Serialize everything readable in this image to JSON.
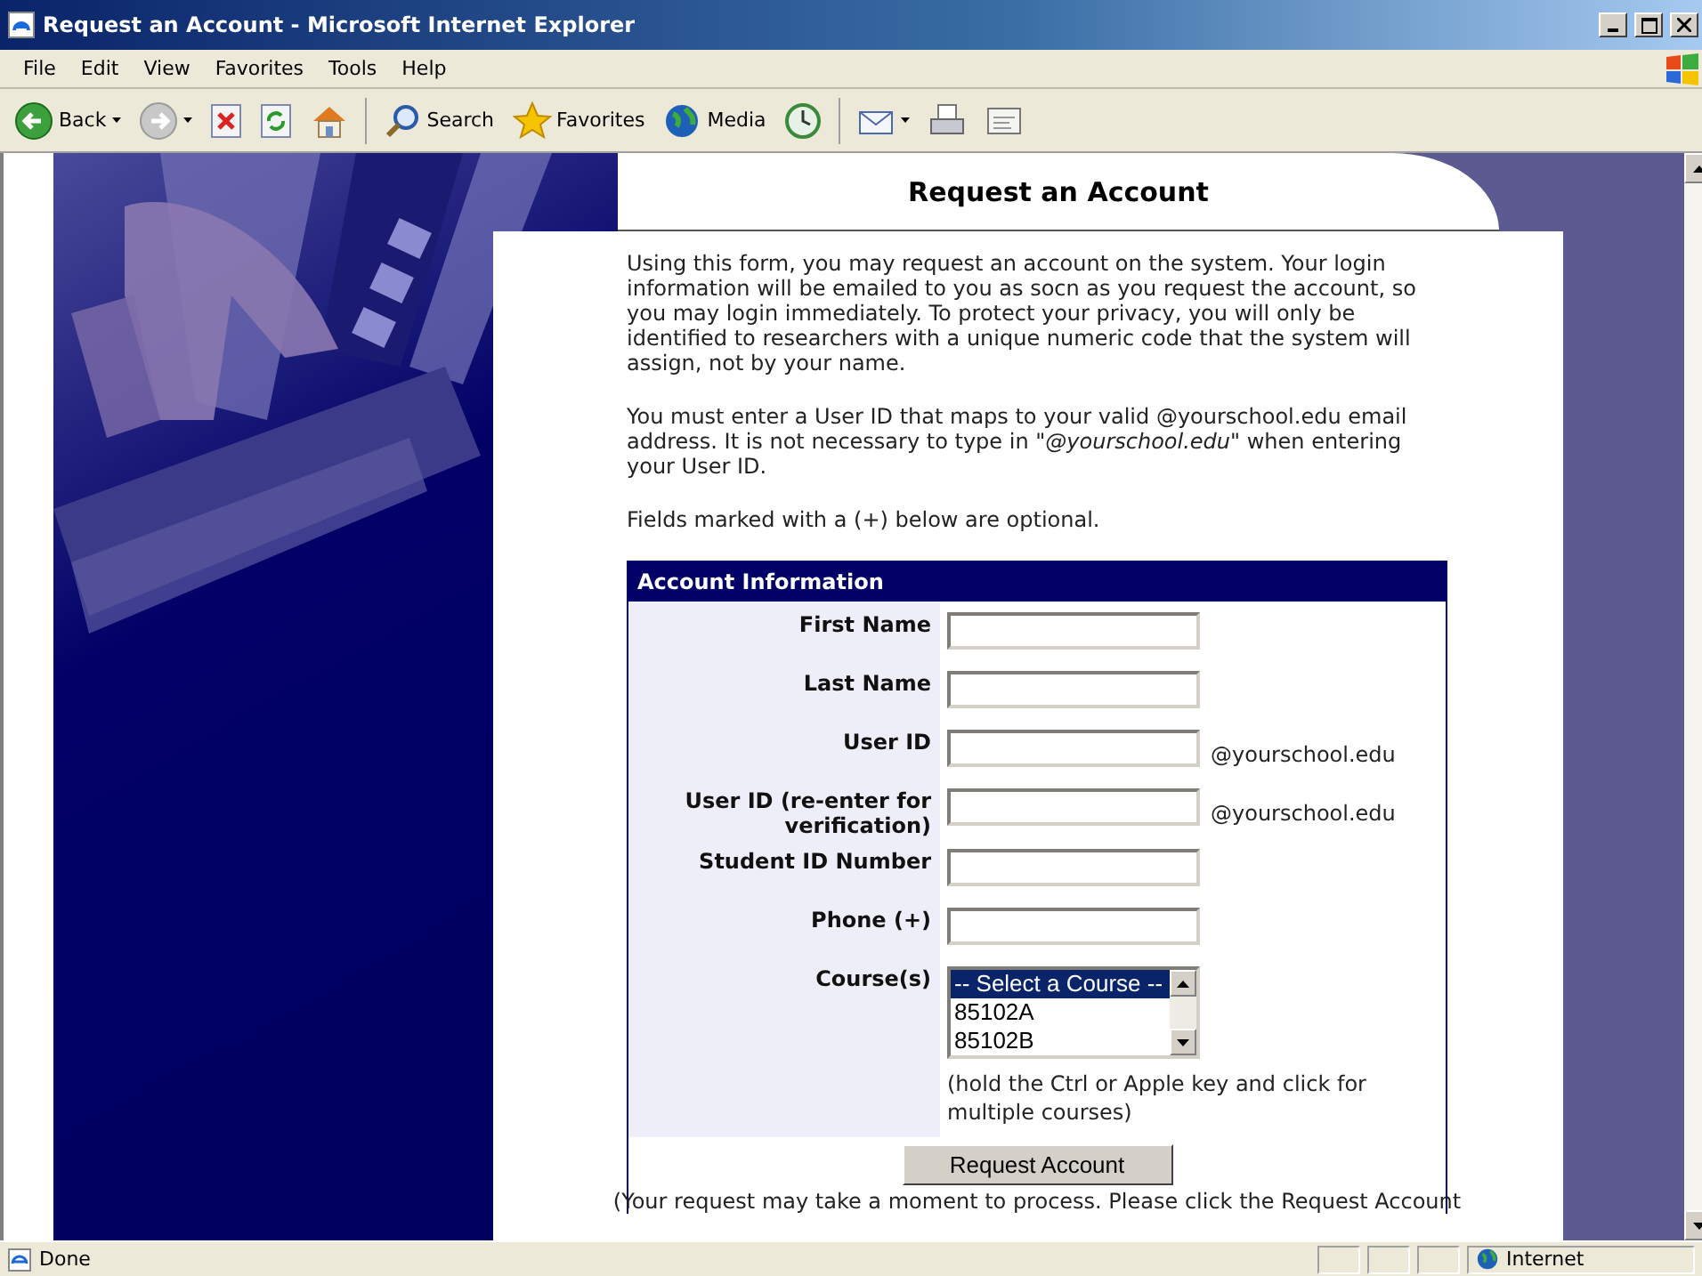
{
  "window": {
    "title": "Request an Account - Microsoft Internet Explorer"
  },
  "menu": [
    "File",
    "Edit",
    "View",
    "Favorites",
    "Tools",
    "Help"
  ],
  "toolbar": [
    {
      "kind": "back",
      "label": "Back",
      "has_menu": true
    },
    {
      "kind": "forward",
      "has_menu": true
    },
    {
      "kind": "stop"
    },
    {
      "kind": "refresh"
    },
    {
      "kind": "home"
    },
    {
      "kind": "search",
      "label": "Search"
    },
    {
      "kind": "favorites",
      "label": "Favorites"
    },
    {
      "kind": "media",
      "label": "Media"
    },
    {
      "kind": "history"
    },
    {
      "kind": "mail",
      "has_menu": true
    },
    {
      "kind": "print"
    },
    {
      "kind": "edit"
    }
  ],
  "page": {
    "heading": "Request an Account",
    "paragraphs": [
      "Using this form, you may request an account on the system. Your login information will be emailed to you as socn as you request the account, so you may login immediately. To protect your privacy, you will only be identified to researchers with a unique numeric code that the system will assign, not by your name.",
      "You must enter a User ID that maps to your valid @yourschool.edu email address. It is not necessary to type in \"*@yourschool.edu*\" when entering your User ID.",
      "Fields marked with a (+) below are optional."
    ],
    "form": {
      "title": "Account Information",
      "fields": [
        {
          "kind": "text",
          "label": "First Name"
        },
        {
          "kind": "text",
          "label": "Last Name"
        },
        {
          "kind": "text",
          "label": "User ID",
          "suffix": "@yourschool.edu"
        },
        {
          "kind": "text",
          "label": "User ID (re-enter for verification)",
          "suffix": "@yourschool.edu"
        },
        {
          "kind": "text",
          "label": "Student ID Number"
        },
        {
          "kind": "text",
          "label": "Phone (+)"
        },
        {
          "kind": "listbox",
          "label": "Course(s)",
          "options": [
            {
              "label": "-- Select a Course --",
              "selected": true
            },
            {
              "label": "85102A",
              "selected": false
            },
            {
              "label": "85102B",
              "selected": false
            }
          ],
          "hint": "(hold the Ctrl or Apple key and click for multiple courses)"
        }
      ],
      "submit": "Request Account",
      "note": "(Your request may take a moment to process. Please click the Request Account"
    }
  },
  "status_bar": {
    "text": "Done",
    "zone": "Internet"
  }
}
